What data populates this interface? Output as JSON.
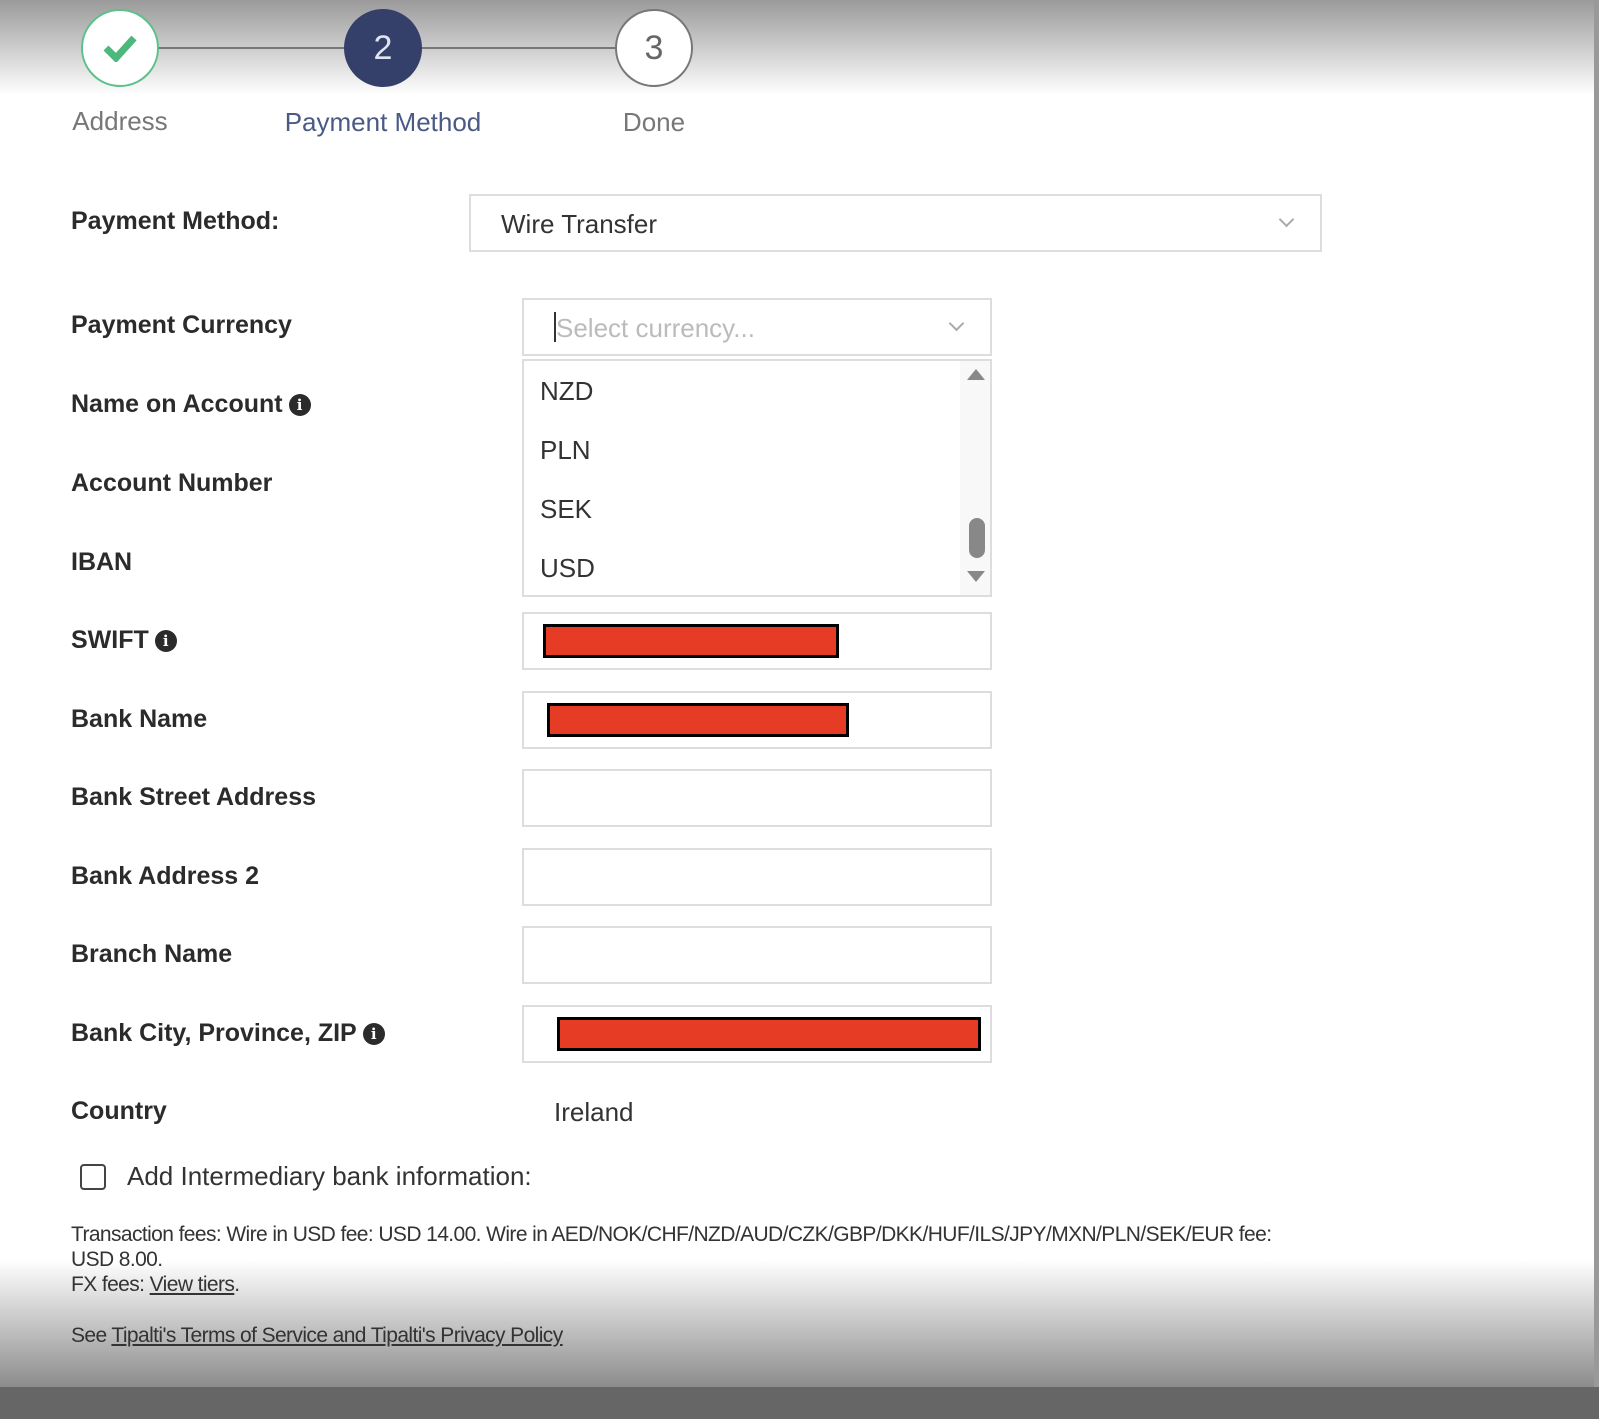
{
  "steps": [
    {
      "label": "Address",
      "state": "complete",
      "icon": "check-icon"
    },
    {
      "label": "Payment Method",
      "number": "2",
      "state": "active"
    },
    {
      "label": "Done",
      "number": "3",
      "state": "pending"
    }
  ],
  "payment_method": {
    "label": "Payment Method:",
    "value": "Wire Transfer"
  },
  "currency": {
    "label": "Payment Currency",
    "placeholder": "Select currency...",
    "options": [
      "NZD",
      "PLN",
      "SEK",
      "USD"
    ]
  },
  "fields": [
    {
      "label": "Name on Account",
      "info": true
    },
    {
      "label": "Account Number"
    },
    {
      "label": "IBAN"
    },
    {
      "label": "SWIFT",
      "info": true
    },
    {
      "label": "Bank Name"
    },
    {
      "label": "Bank Street Address"
    },
    {
      "label": "Bank Address 2"
    },
    {
      "label": "Branch Name"
    },
    {
      "label": "Bank City, Province, ZIP",
      "info": true
    }
  ],
  "country": {
    "label": "Country",
    "value": "Ireland"
  },
  "intermediary": {
    "label": "Add Intermediary bank information:",
    "checked": false
  },
  "fees": {
    "line1": "Transaction fees: Wire in USD fee: USD 14.00. Wire in AED/NOK/CHF/NZD/AUD/CZK/GBP/DKK/HUF/ILS/JPY/MXN/PLN/SEK/EUR fee:",
    "line2": "USD 8.00.",
    "fx_prefix": "FX fees: ",
    "fx_link": "View tiers",
    "fx_suffix": ".",
    "terms_prefix": "See ",
    "terms_link": "Tipalti's Terms of Service and Tipalti's Privacy Policy"
  },
  "colors": {
    "complete": "#4cb87c",
    "active": "#34406a",
    "redaction": "#e63c26"
  }
}
